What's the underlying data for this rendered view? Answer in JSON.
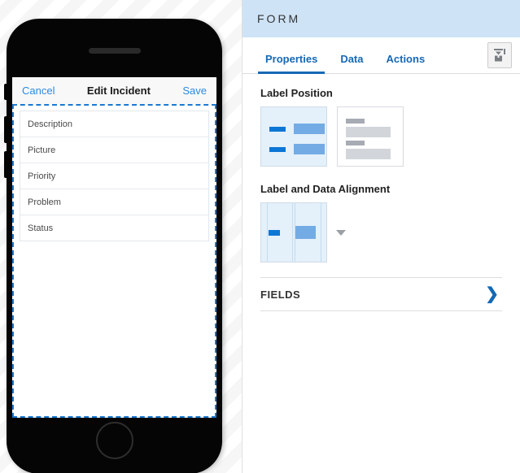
{
  "colors": {
    "accent": "#1569b5",
    "panel_header_bg": "#cee3f6",
    "link_blue": "#2b8ae0",
    "selection_bg": "#e4f0fa",
    "bar_dark_blue": "#0c76d4",
    "bar_light_blue": "#73ace5",
    "bar_dark_gray": "#a7abb3",
    "bar_light_gray": "#d2d5da",
    "device_body": "#050505",
    "dashed_outline": "#1a7ad4"
  },
  "device": {
    "name": "phone-preview",
    "screen": {
      "navbar": {
        "cancel_label": "Cancel",
        "title": "Edit Incident",
        "save_label": "Save"
      },
      "form": {
        "fields": [
          {
            "label": "Description"
          },
          {
            "label": "Picture"
          },
          {
            "label": "Priority"
          },
          {
            "label": "Problem"
          },
          {
            "label": "Status"
          }
        ]
      }
    },
    "speaker": "speaker-grille",
    "home_button": "home-button"
  },
  "panel": {
    "header": {
      "title": "FORM"
    },
    "tabs": [
      {
        "label": "Properties",
        "active": true
      },
      {
        "label": "Data",
        "active": false
      },
      {
        "label": "Actions",
        "active": false
      }
    ],
    "tab_action_icon": "collapse-panel-icon",
    "sections": {
      "label_position": {
        "title": "Label Position",
        "options": [
          {
            "name": "label-position-side",
            "selected": true
          },
          {
            "name": "label-position-above",
            "selected": false
          }
        ]
      },
      "label_data_alignment": {
        "title": "Label and Data Alignment",
        "options": [
          {
            "name": "alignment-left",
            "selected": true
          }
        ],
        "dropdown_icon": "caret-down-icon"
      },
      "fields": {
        "title": "FIELDS",
        "chevron": "❯"
      }
    }
  }
}
